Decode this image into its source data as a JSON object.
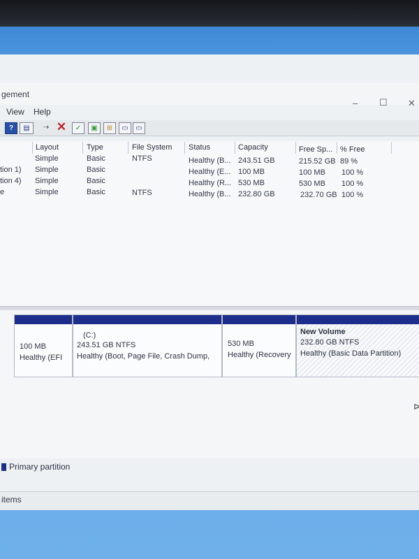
{
  "window": {
    "title": "gement",
    "minimize": "–",
    "maximize": "☐",
    "close": "✕"
  },
  "menu": [
    "View",
    "Help"
  ],
  "toolbar": [
    {
      "icon": "help-icon",
      "glyph": "?"
    },
    {
      "icon": "disk-list-icon",
      "glyph": "▤"
    },
    {
      "icon": "connect-icon",
      "glyph": "⇢"
    },
    {
      "icon": "delete-icon",
      "glyph": "✕"
    },
    {
      "icon": "check-icon",
      "glyph": "✓"
    },
    {
      "icon": "new-volume-icon",
      "glyph": "▣"
    },
    {
      "icon": "properties-icon",
      "glyph": "⊞"
    },
    {
      "icon": "folder-icon",
      "glyph": "▭"
    },
    {
      "icon": "disk-view-icon",
      "glyph": "▭"
    }
  ],
  "volume_table": {
    "columns": [
      "Layout",
      "Type",
      "File System",
      "Status",
      "Capacity",
      "Free Sp...",
      "% Free"
    ],
    "rows": [
      {
        "volume": "",
        "layout": "Simple",
        "type": "Basic",
        "fs": "NTFS",
        "status": "Healthy (B...",
        "capacity": "243.51 GB",
        "free": "215.52 GB",
        "pct": "89 %"
      },
      {
        "volume": "tion 1)",
        "layout": "Simple",
        "type": "Basic",
        "fs": "",
        "status": "Healthy (E...",
        "capacity": "100 MB",
        "free": "100 MB",
        "pct": "100 %"
      },
      {
        "volume": "tion 4)",
        "layout": "Simple",
        "type": "Basic",
        "fs": "",
        "status": "Healthy (R...",
        "capacity": "530 MB",
        "free": "530 MB",
        "pct": "100 %"
      },
      {
        "volume": "e",
        "layout": "Simple",
        "type": "Basic",
        "fs": "NTFS",
        "status": "Healthy (B...",
        "capacity": "232.80 GB",
        "free": "232.70 GB",
        "pct": "100 %"
      }
    ]
  },
  "partitions": [
    {
      "name": "",
      "size": "100 MB",
      "status": "Healthy (EFI"
    },
    {
      "name": "(C:)",
      "size": "243.51 GB NTFS",
      "status": "Healthy (Boot, Page File, Crash Dump,"
    },
    {
      "name": "",
      "size": "530 MB",
      "status": "Healthy (Recovery"
    },
    {
      "name": "New Volume",
      "size": "232.80 GB NTFS",
      "status": "Healthy (Basic Data Partition)"
    }
  ],
  "legend": {
    "primary": "Primary partition"
  },
  "statusbar": {
    "text": "items"
  },
  "colors": {
    "partition_bar": "#1c2d8c",
    "delete": "#c0232a"
  }
}
